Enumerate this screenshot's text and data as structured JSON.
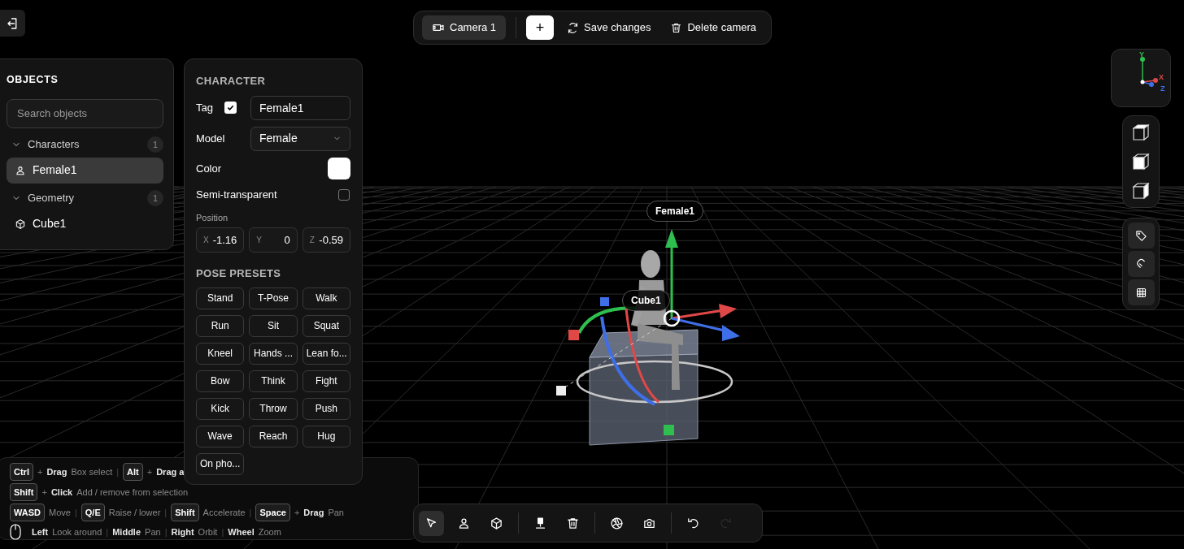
{
  "top_toolbar": {
    "camera_tab": {
      "label": "Camera 1",
      "selected": true
    },
    "add_button": "+",
    "save_button": "Save changes",
    "delete_button": "Delete camera"
  },
  "objects_panel": {
    "title": "OBJECTS",
    "search": {
      "placeholder": "Search objects"
    },
    "groups": [
      {
        "label": "Characters",
        "count": "1",
        "expanded": true,
        "items": [
          {
            "label": "Female1",
            "kind": "character",
            "selected": true
          }
        ]
      },
      {
        "label": "Geometry",
        "count": "1",
        "expanded": true,
        "items": [
          {
            "label": "Cube1",
            "kind": "cube",
            "selected": false
          }
        ]
      }
    ]
  },
  "character_panel": {
    "title": "CHARACTER",
    "tag": {
      "label": "Tag",
      "checked": true,
      "value": "Female1"
    },
    "model": {
      "label": "Model",
      "value": "Female"
    },
    "color": {
      "label": "Color",
      "color": "#ffffff"
    },
    "semi_transparent": {
      "label": "Semi-transparent",
      "checked": false
    },
    "position": {
      "label": "Position",
      "fields": [
        {
          "axis": "X",
          "value": "-1.16"
        },
        {
          "axis": "Y",
          "value": "0"
        },
        {
          "axis": "Z",
          "value": "-0.59"
        }
      ]
    },
    "pose_presets": {
      "title": "POSE PRESETS",
      "presets": [
        "Stand",
        "T-Pose",
        "Walk",
        "Run",
        "Sit",
        "Squat",
        "Kneel",
        "Hands ...",
        "Lean fo...",
        "Bow",
        "Think",
        "Fight",
        "Kick",
        "Throw",
        "Push",
        "Wave",
        "Reach",
        "Hug",
        "On pho..."
      ]
    }
  },
  "shortcuts": [
    [
      {
        "kind": "key",
        "text": "Ctrl"
      },
      {
        "kind": "plus",
        "text": "+"
      },
      {
        "kind": "action",
        "text": "Drag"
      },
      {
        "kind": "desc",
        "text": "Box select"
      },
      {
        "kind": "sep",
        "text": "|"
      },
      {
        "kind": "key",
        "text": "Alt"
      },
      {
        "kind": "plus",
        "text": "+"
      },
      {
        "kind": "action",
        "text": "Drag a"
      }
    ],
    [
      {
        "kind": "key",
        "text": "Shift"
      },
      {
        "kind": "plus",
        "text": "+"
      },
      {
        "kind": "action",
        "text": "Click"
      },
      {
        "kind": "desc",
        "text": "Add / remove from selection"
      }
    ],
    [
      {
        "kind": "key",
        "text": "WASD"
      },
      {
        "kind": "desc",
        "text": "Move"
      },
      {
        "kind": "sep",
        "text": "|"
      },
      {
        "kind": "key",
        "text": "Q/E"
      },
      {
        "kind": "desc",
        "text": "Raise / lower"
      },
      {
        "kind": "sep",
        "text": "|"
      },
      {
        "kind": "key",
        "text": "Shift"
      },
      {
        "kind": "desc",
        "text": "Accelerate"
      },
      {
        "kind": "sep",
        "text": "|"
      },
      {
        "kind": "key",
        "text": "Space"
      },
      {
        "kind": "plus",
        "text": "+"
      },
      {
        "kind": "action",
        "text": "Drag"
      },
      {
        "kind": "desc",
        "text": "Pan"
      }
    ],
    [
      {
        "kind": "mouse"
      },
      {
        "kind": "action",
        "text": "Left"
      },
      {
        "kind": "desc",
        "text": "Look around"
      },
      {
        "kind": "sep",
        "text": "|"
      },
      {
        "kind": "action",
        "text": "Middle"
      },
      {
        "kind": "desc",
        "text": "Pan"
      },
      {
        "kind": "sep",
        "text": "|"
      },
      {
        "kind": "action",
        "text": "Right"
      },
      {
        "kind": "desc",
        "text": "Orbit"
      },
      {
        "kind": "sep",
        "text": "|"
      },
      {
        "kind": "action",
        "text": "Wheel"
      },
      {
        "kind": "desc",
        "text": "Zoom"
      }
    ]
  ],
  "viewport": {
    "labels": [
      {
        "kind": "character",
        "text": "Female1"
      },
      {
        "kind": "cube",
        "text": "Cube1"
      }
    ],
    "axis_gizmo": {
      "x": "X",
      "y": "Y",
      "z": "Z"
    }
  },
  "view_buttons": [
    {
      "kind": "top"
    },
    {
      "kind": "front"
    },
    {
      "kind": "side"
    }
  ],
  "tool_buttons": [
    {
      "kind": "tag"
    },
    {
      "kind": "magnet"
    },
    {
      "kind": "grid"
    }
  ],
  "bottom_toolbar": [
    {
      "kind": "select",
      "selected": true,
      "disabled": false
    },
    {
      "kind": "person",
      "selected": false,
      "disabled": false
    },
    {
      "kind": "cube",
      "selected": false,
      "disabled": false
    },
    {
      "kind": "divider"
    },
    {
      "kind": "drop",
      "selected": false,
      "disabled": false
    },
    {
      "kind": "trash",
      "selected": false,
      "disabled": false
    },
    {
      "kind": "divider"
    },
    {
      "kind": "aperture",
      "selected": false,
      "disabled": false
    },
    {
      "kind": "camera",
      "selected": false,
      "disabled": false
    },
    {
      "kind": "divider"
    },
    {
      "kind": "undo",
      "selected": false,
      "disabled": false
    },
    {
      "kind": "redo",
      "selected": false,
      "disabled": true
    }
  ]
}
